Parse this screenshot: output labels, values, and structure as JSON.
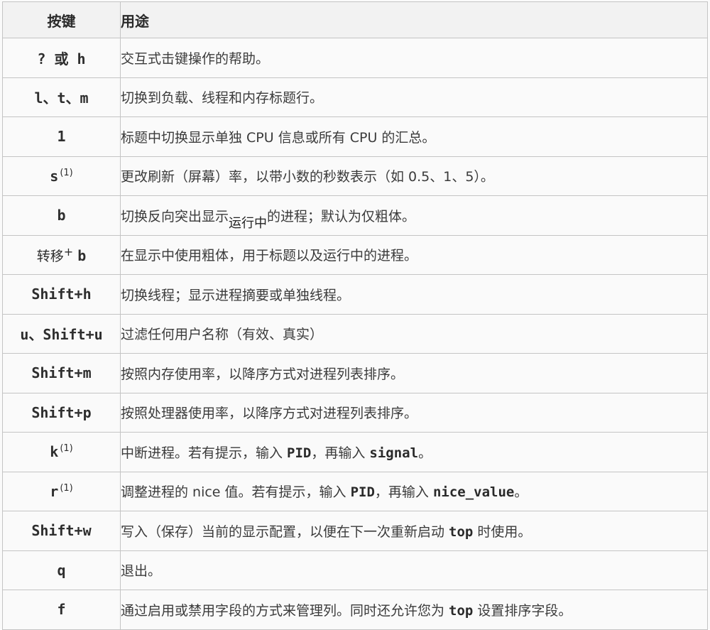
{
  "header": {
    "key": "按键",
    "usage": "用途"
  },
  "rows": [
    {
      "key": "? 或 h",
      "usage": "交互式击键操作的帮助。"
    },
    {
      "key": "l、t、m",
      "usage": "切换到负载、线程和内存标题行。"
    },
    {
      "key": "1",
      "usage": "标题中切换显示单独 CPU 信息或所有 CPU 的汇总。"
    },
    {
      "key": "s",
      "sup": "(1)",
      "usage": "更改刷新（屏幕）率，以带小数的秒数表示（如 0.5、1、5）。"
    },
    {
      "key": "b",
      "usage_parts": [
        "切换反向突出显示",
        "运行中",
        "的进程；默认为仅粗体。"
      ]
    },
    {
      "key_prefix": "转移",
      "key_plus": "+",
      "key": "b",
      "usage": "在显示中使用粗体，用于标题以及运行中的进程。"
    },
    {
      "key": "Shift+h",
      "usage": "切换线程；显示进程摘要或单独线程。"
    },
    {
      "key": "u、Shift+u",
      "usage": "过滤任何用户名称（有效、真实）"
    },
    {
      "key": "Shift+m",
      "usage": "按照内存使用率，以降序方式对进程列表排序。"
    },
    {
      "key": "Shift+p",
      "usage": "按照处理器使用率，以降序方式对进程列表排序。"
    },
    {
      "key": "k",
      "sup": "(1)",
      "usage_parts": [
        "中断进程。若有提示，输入 ",
        "PID",
        "，再输入 ",
        "signal",
        "。"
      ]
    },
    {
      "key": "r",
      "sup": "(1)",
      "usage_parts": [
        "调整进程的 nice 值。若有提示，输入 ",
        "PID",
        "，再输入 ",
        "nice_value",
        "。"
      ]
    },
    {
      "key": "Shift+w",
      "usage_parts": [
        "写入（保存）当前的显示配置，以便在下一次重新启动 ",
        "top",
        " 时使用。"
      ]
    },
    {
      "key": "q",
      "usage": "退出。"
    },
    {
      "key": "f",
      "usage_parts": [
        "通过启用或禁用字段的方式来管理列。同时还允许您为 ",
        "top",
        " 设置排序字段。"
      ]
    }
  ]
}
